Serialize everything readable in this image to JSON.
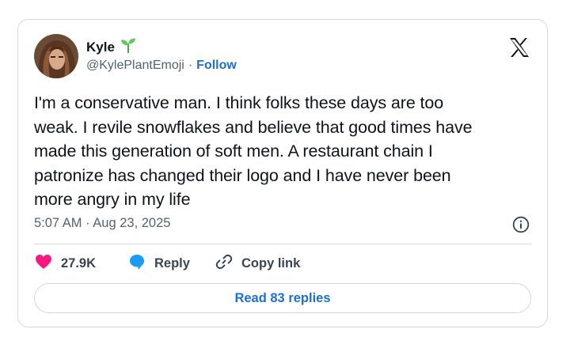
{
  "author": {
    "name": "Kyle",
    "name_emoji": "sprout-icon",
    "handle": "@KylePlantEmoji",
    "separator": "·",
    "follow_label": "Follow"
  },
  "tweet": {
    "text": "I'm a conservative man. I think folks these days are too\nweak. I revile snowflakes and believe that good times have\nmade this generation of soft men. A restaurant chain I\npatronize has changed their logo and I have never been\nmore angry in my life",
    "timestamp": "5:07 AM · Aug 23, 2025"
  },
  "actions": {
    "likes_count": "27.9K",
    "reply_label": "Reply",
    "copy_link_label": "Copy link"
  },
  "read_replies_label": "Read 83 replies",
  "colors": {
    "accent": "#1d6fd6",
    "like": "#f91880",
    "reply": "#1d9bf0",
    "muted": "#536471"
  }
}
